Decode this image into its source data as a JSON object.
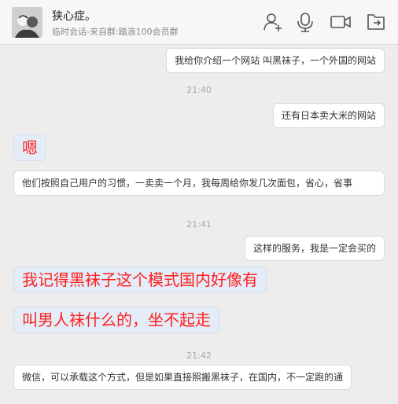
{
  "header": {
    "title": "狭心症。",
    "subtitle": "临时会话-来自群:踏浪100会员群",
    "icons": [
      "add-contact-icon",
      "voice-call-icon",
      "video-call-icon",
      "share-screen-icon"
    ]
  },
  "messages": [
    {
      "side": "right",
      "text": "我给你介绍一个网站 叫黑袜子，一个外国的网站"
    },
    {
      "type": "time",
      "text": "21:40"
    },
    {
      "side": "right",
      "text": "还有日本卖大米的网站"
    },
    {
      "side": "left",
      "emphasis": true,
      "text": "嗯"
    },
    {
      "side": "left",
      "text": "他们按照自己用户的习惯，一卖卖一个月，我每周给你发几次面包，省心，省事"
    },
    {
      "type": "time",
      "text": "21:41"
    },
    {
      "side": "right",
      "text": "这样的服务，我是一定会买的"
    },
    {
      "side": "left",
      "emphasis": true,
      "text": "我记得黑袜子这个模式国内好像有"
    },
    {
      "side": "left",
      "emphasis": true,
      "text": "叫男人袜什么的，坐不起走"
    },
    {
      "type": "time",
      "text": "21:42"
    },
    {
      "side": "left",
      "text": "微信，可以承载这个方式，但是如果直接照搬黑袜子，在国内，不一定跑的通"
    }
  ],
  "colors": {
    "emphasis_text": "#ff1f1f",
    "emphasis_bubble": "#e4edf7",
    "bubble": "#ffffff",
    "background": "#ededed"
  }
}
